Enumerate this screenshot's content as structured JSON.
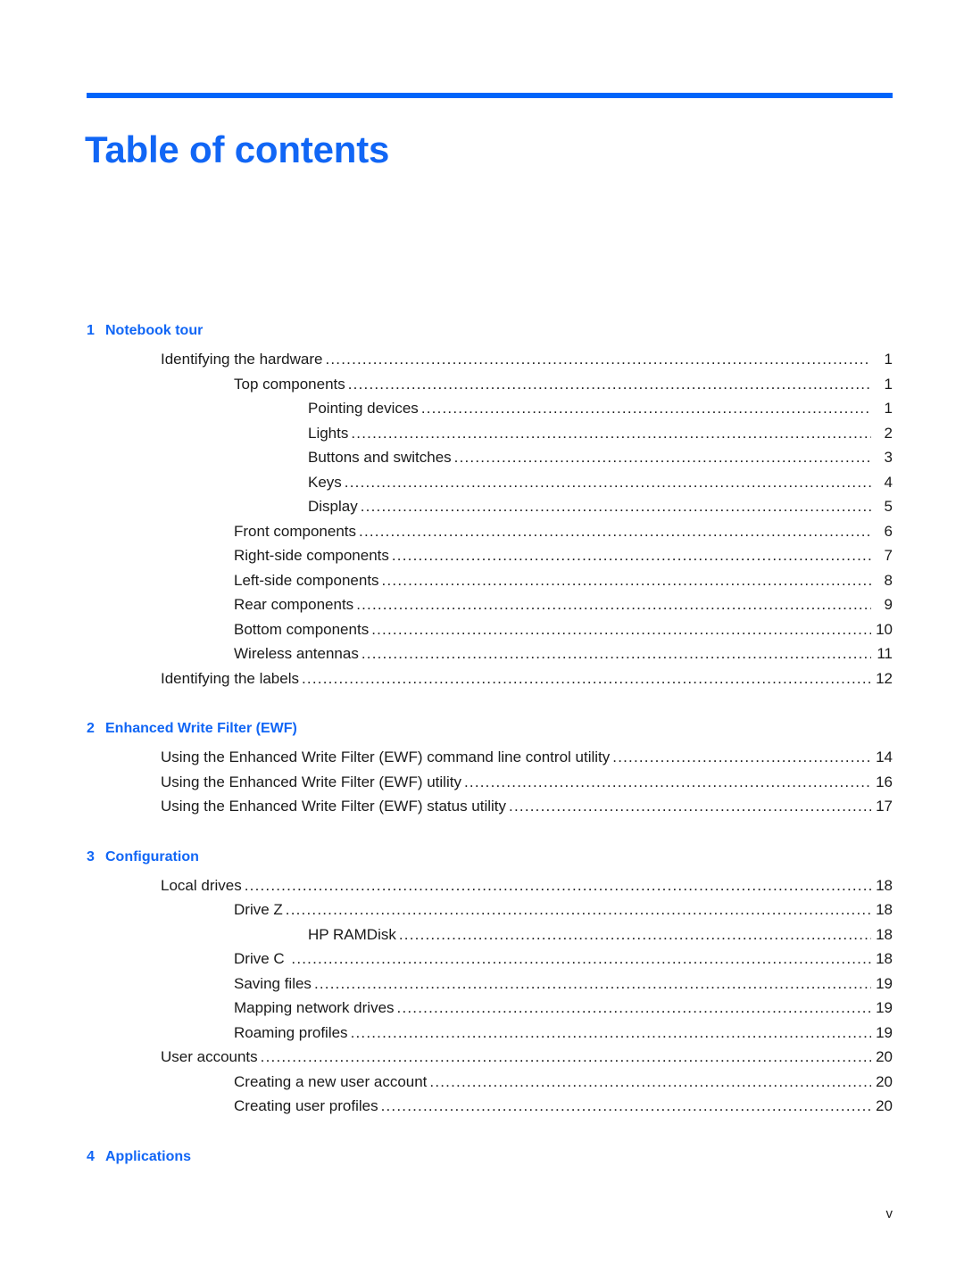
{
  "document": {
    "title": "Table of contents",
    "footer_page_number": "v",
    "accent_color": "#1166f5",
    "rule_color": "#0064fa",
    "text_color": "#1a1a1a"
  },
  "chapters": [
    {
      "number": "1",
      "title": "Notebook tour",
      "entries": [
        {
          "level": 1,
          "label": "Identifying the hardware",
          "page": "1"
        },
        {
          "level": 2,
          "label": "Top components",
          "page": "1"
        },
        {
          "level": 3,
          "label": "Pointing devices",
          "page": "1"
        },
        {
          "level": 3,
          "label": "Lights",
          "page": "2"
        },
        {
          "level": 3,
          "label": "Buttons and switches",
          "page": "3"
        },
        {
          "level": 3,
          "label": "Keys",
          "page": "4"
        },
        {
          "level": 3,
          "label": "Display",
          "page": "5"
        },
        {
          "level": 2,
          "label": "Front components",
          "page": "6"
        },
        {
          "level": 2,
          "label": "Right-side components",
          "page": "7"
        },
        {
          "level": 2,
          "label": "Left-side components",
          "page": "8"
        },
        {
          "level": 2,
          "label": "Rear components",
          "page": "9"
        },
        {
          "level": 2,
          "label": "Bottom components",
          "page": "10"
        },
        {
          "level": 2,
          "label": "Wireless antennas",
          "page": "11"
        },
        {
          "level": 1,
          "label": "Identifying the labels",
          "page": "12"
        }
      ]
    },
    {
      "number": "2",
      "title": "Enhanced Write Filter (EWF)",
      "entries": [
        {
          "level": 1,
          "label": "Using the Enhanced Write Filter (EWF) command line control utility",
          "page": "14"
        },
        {
          "level": 1,
          "label": "Using the Enhanced Write Filter (EWF) utility",
          "page": "16"
        },
        {
          "level": 1,
          "label": "Using the Enhanced Write Filter (EWF) status utility",
          "page": "17"
        }
      ]
    },
    {
      "number": "3",
      "title": "Configuration",
      "entries": [
        {
          "level": 1,
          "label": "Local drives",
          "page": "18"
        },
        {
          "level": 2,
          "label": "Drive Z",
          "page": "18"
        },
        {
          "level": 3,
          "label": "HP RAMDisk",
          "page": "18"
        },
        {
          "level": 2,
          "label": "Drive C ",
          "page": "18"
        },
        {
          "level": 2,
          "label": "Saving files",
          "page": "19"
        },
        {
          "level": 2,
          "label": "Mapping network drives",
          "page": "19"
        },
        {
          "level": 2,
          "label": "Roaming profiles",
          "page": "19"
        },
        {
          "level": 1,
          "label": "User accounts",
          "page": "20"
        },
        {
          "level": 2,
          "label": "Creating a new user account",
          "page": "20"
        },
        {
          "level": 2,
          "label": "Creating user profiles",
          "page": "20"
        }
      ]
    },
    {
      "number": "4",
      "title": "Applications",
      "entries": []
    }
  ]
}
